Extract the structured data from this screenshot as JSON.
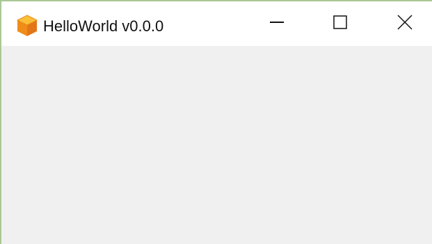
{
  "window": {
    "title": "HelloWorld v0.0.0",
    "icon": "orange-cube-app-icon",
    "controls": {
      "minimize_icon": "minimize-icon",
      "maximize_icon": "maximize-icon",
      "close_icon": "close-icon"
    }
  },
  "colors": {
    "titlebar_bg": "#ffffff",
    "client_bg": "#f0f0f0",
    "window_border": "#a9c795",
    "icon_orange": "#f5a623"
  }
}
